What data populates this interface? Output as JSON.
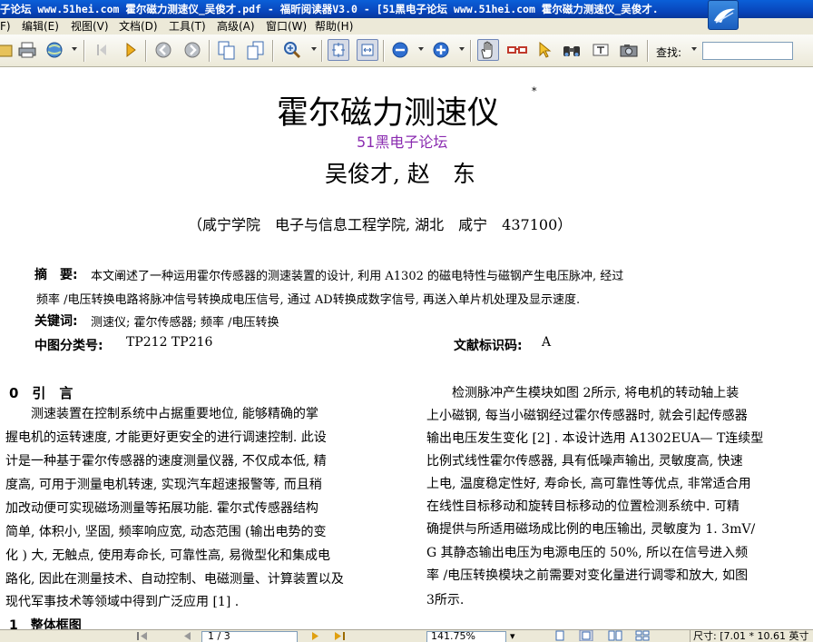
{
  "window": {
    "title": "子论坛 www.51hei.com 霍尔磁力测速仪_吴俊才.pdf - 福昕阅读器V3.0 - [51黑电子论坛 www.51hei.com 霍尔磁力测速仪_吴俊才.",
    "accent": "#0a5fd8"
  },
  "menu": {
    "items": [
      "F)",
      "编辑(E)",
      "视图(V)",
      "文档(D)",
      "工具(T)",
      "高级(A)",
      "窗口(W)",
      "帮助(H)"
    ]
  },
  "toolbar": {
    "find_label": "查找:",
    "find_value": "",
    "icons": [
      "folder-icon",
      "printer-icon",
      "globe-icon",
      "nav-first-icon",
      "nav-next-icon",
      "nav-back-icon",
      "nav-forward-icon",
      "copy-page-icon",
      "paste-page-icon",
      "zoom-in-tool-icon",
      "fit-page-icon",
      "fit-width-icon",
      "zoom-out-icon",
      "zoom-plus-icon",
      "hand-tool-icon",
      "glasses-icon",
      "select-arrow-icon",
      "binoculars-icon",
      "camera-icon"
    ]
  },
  "document": {
    "title": "霍尔磁力测速仪",
    "title_mark": "*",
    "watermark": "51黑电子论坛",
    "watermark_color": "#8a2bb0",
    "authors": "吴俊才, 赵　东",
    "affiliation": "（咸宁学院　电子与信息工程学院, 湖北　咸宁　437100）",
    "abstract_label": "摘　要:",
    "abstract_line1": "本文阐述了一种运用霍尔传感器的测速装置的设计, 利用 A1302 的磁电特性与磁钢产生电压脉冲, 经过",
    "abstract_line2": "频率 /电压转换电路将脉冲信号转换成电压信号, 通过 AD转换成数字信号, 再送入单片机处理及显示速度.",
    "keywords_label": "关键词:",
    "keywords": "测速仪; 霍尔传感器; 频率 /电压转换",
    "clc_label": "中图分类号:",
    "clc": "TP212  TP216",
    "doc_code_label": "文献标识码:",
    "doc_code": "A",
    "section0_title": "0　引　言",
    "left_col": [
      "　　测速装置在控制系统中占据重要地位, 能够精确的掌",
      "握电机的运转速度, 才能更好更安全的进行调速控制. 此设",
      "计是一种基于霍尔传感器的速度测量仪器, 不仅成本低, 精",
      "度高, 可用于测量电机转速, 实现汽车超速报警等, 而且稍",
      "加改动便可实现磁场测量等拓展功能. 霍尔式传感器结构",
      "简单, 体积小, 坚固, 频率响应宽, 动态范围 (输出电势的变",
      "化 ) 大, 无触点, 使用寿命长, 可靠性高, 易微型化和集成电",
      "路化, 因此在测量技术、自动控制、电磁测量、计算装置以及",
      "现代军事技术等领域中得到广泛应用 [1] ."
    ],
    "section1_title": "1　整体框图",
    "right_col": [
      "　　检测脉冲产生模块如图 2所示, 将电机的转动轴上装",
      "上小磁钢, 每当小磁钢经过霍尔传感器时, 就会引起传感器",
      "输出电压发生变化 [2] . 本设计选用 A1302EUA— T连续型",
      "比例式线性霍尔传感器, 具有低噪声输出, 灵敏度高, 快速",
      "上电, 温度稳定性好, 寿命长, 高可靠性等优点, 非常适合用",
      "在线性目标移动和旋转目标移动的位置检测系统中. 可精",
      "确提供与所适用磁场成比例的电压输出, 灵敏度为 1. 3mV/",
      "G 其静态输出电压为电源电压的 50%, 所以在信号进入频",
      "率 /电压转换模块之前需要对变化量进行调零和放大, 如图",
      "3所示."
    ]
  },
  "statusbar": {
    "page": "1 / 3",
    "zoom": "141.75%",
    "size": "尺寸: [7.01 * 10.61 英寸"
  }
}
